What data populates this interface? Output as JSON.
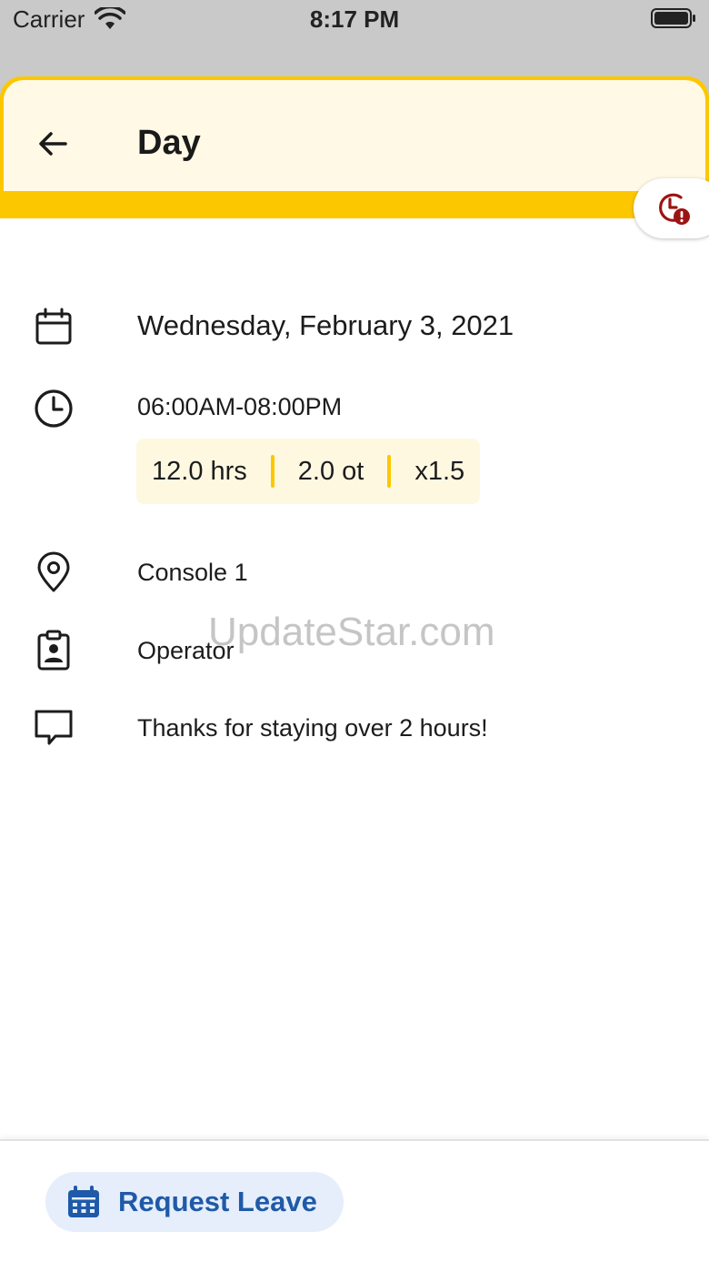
{
  "status_bar": {
    "carrier": "Carrier",
    "time": "8:17 PM"
  },
  "header": {
    "title": "Day",
    "accent_color": "#fdc700",
    "card_color": "#fff9e6",
    "alert_icon": "clock-alert-icon",
    "alert_color": "#9b1414"
  },
  "shift": {
    "date": "Wednesday, February 3, 2021",
    "time_range": "06:00AM-08:00PM",
    "stats": {
      "hours": "12.0 hrs",
      "overtime": "2.0 ot",
      "multiplier": "x1.5"
    },
    "location": "Console 1",
    "role": "Operator",
    "note": "Thanks for staying over 2 hours!"
  },
  "icons": {
    "date": "calendar-icon",
    "time": "clock-icon",
    "location": "location-pin-icon",
    "role": "badge-icon",
    "note": "comment-icon"
  },
  "watermark": "UpdateStar.com",
  "footer": {
    "request_leave_label": "Request Leave",
    "button_color": "#e6eefb",
    "text_color": "#1f5aa8"
  }
}
